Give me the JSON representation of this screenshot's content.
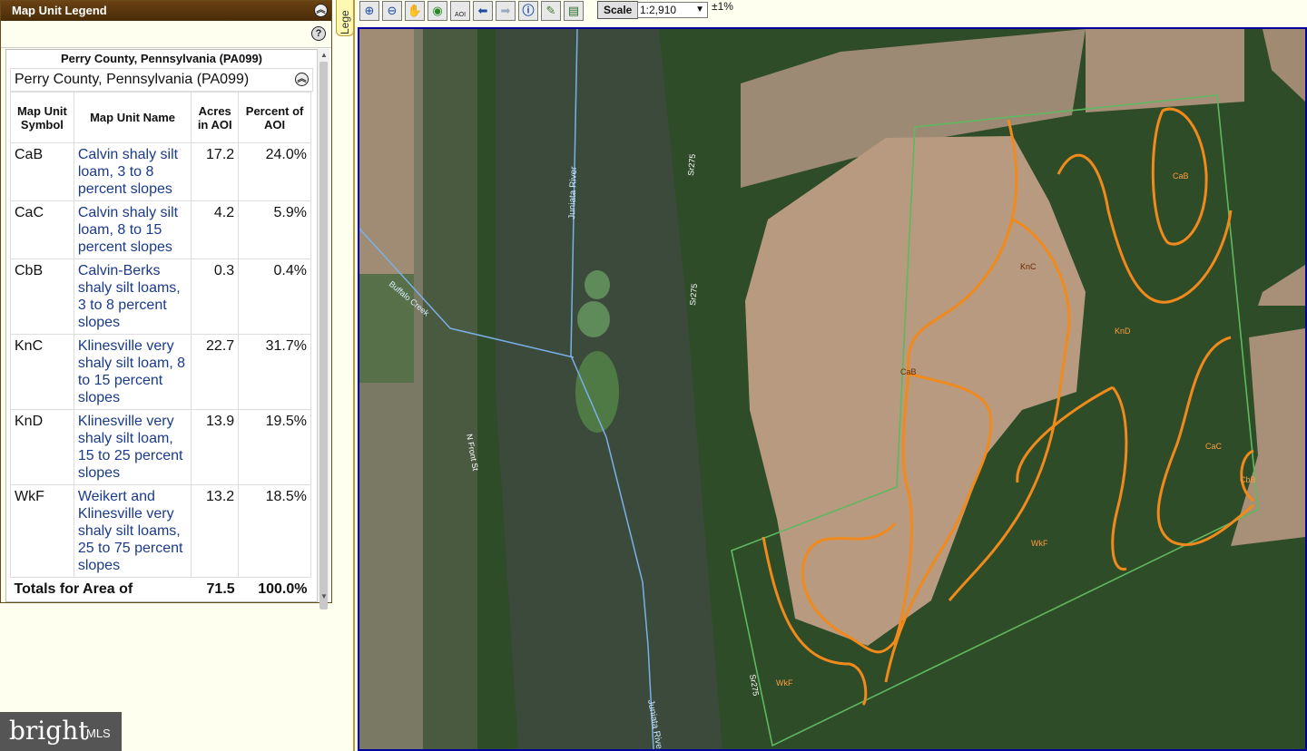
{
  "legend": {
    "title": "Map Unit Legend",
    "survey_area": "Perry County, Pennsylvania (PA099)",
    "county_name": "Perry County, Pennsylvania (PA099)",
    "columns": [
      "Map Unit Symbol",
      "Map Unit Name",
      "Acres in AOI",
      "Percent of AOI"
    ],
    "rows": [
      {
        "symbol": "CaB",
        "name": "Calvin shaly silt loam, 3 to 8 percent slopes",
        "acres": "17.2",
        "percent": "24.0%"
      },
      {
        "symbol": "CaC",
        "name": "Calvin shaly silt loam, 8 to 15 percent slopes",
        "acres": "4.2",
        "percent": "5.9%"
      },
      {
        "symbol": "CbB",
        "name": "Calvin-Berks shaly silt loams, 3 to 8 percent slopes",
        "acres": "0.3",
        "percent": "0.4%"
      },
      {
        "symbol": "KnC",
        "name": "Klinesville very shaly silt loam, 8 to 15 percent slopes",
        "acres": "22.7",
        "percent": "31.7%"
      },
      {
        "symbol": "KnD",
        "name": "Klinesville very shaly silt loam, 15 to 25 percent slopes",
        "acres": "13.9",
        "percent": "19.5%"
      },
      {
        "symbol": "WkF",
        "name": "Weikert and Klinesville very shaly silt loams, 25 to 75 percent slopes",
        "acres": "13.2",
        "percent": "18.5%"
      }
    ],
    "totals": {
      "label": "Totals for Area of",
      "acres": "71.5",
      "percent": "100.0%"
    },
    "tab_label": "Lege"
  },
  "toolbar": {
    "tools": [
      "zoom-in-icon",
      "zoom-out-icon",
      "pan-hand-icon",
      "globe-icon",
      "aoi-icon",
      "back-arrow-icon",
      "forward-arrow-icon",
      "info-icon",
      "measure-icon",
      "print-icon"
    ],
    "aoi_label": "AOI",
    "scale_label": "Scale",
    "scale_value": "1:2,910",
    "accuracy": "±1%"
  },
  "map": {
    "labels": {
      "juniata_river_1": "Juniata River",
      "juniata_river_2": "Juniata River",
      "buffalo_creek": "Buffalo Creek",
      "n_front_st": "N Front St",
      "sr275_1": "Sr275",
      "sr275_2": "Sr275",
      "sr275_3": "Sr275"
    },
    "units": {
      "cab_top": "CaB",
      "knc": "KnC",
      "knd": "KnD",
      "cab_mid": "CaB",
      "cac": "CaC",
      "cbb": "CbB",
      "wkf_right": "WkF",
      "wkf_left": "WkF"
    },
    "colors": {
      "soil_line": "#f08a1c",
      "aoi_line": "#5fb860",
      "river_line": "#7ab0e8",
      "frame": "#0000a0"
    }
  },
  "watermark": {
    "brand": "bright",
    "suffix": "MLS"
  }
}
